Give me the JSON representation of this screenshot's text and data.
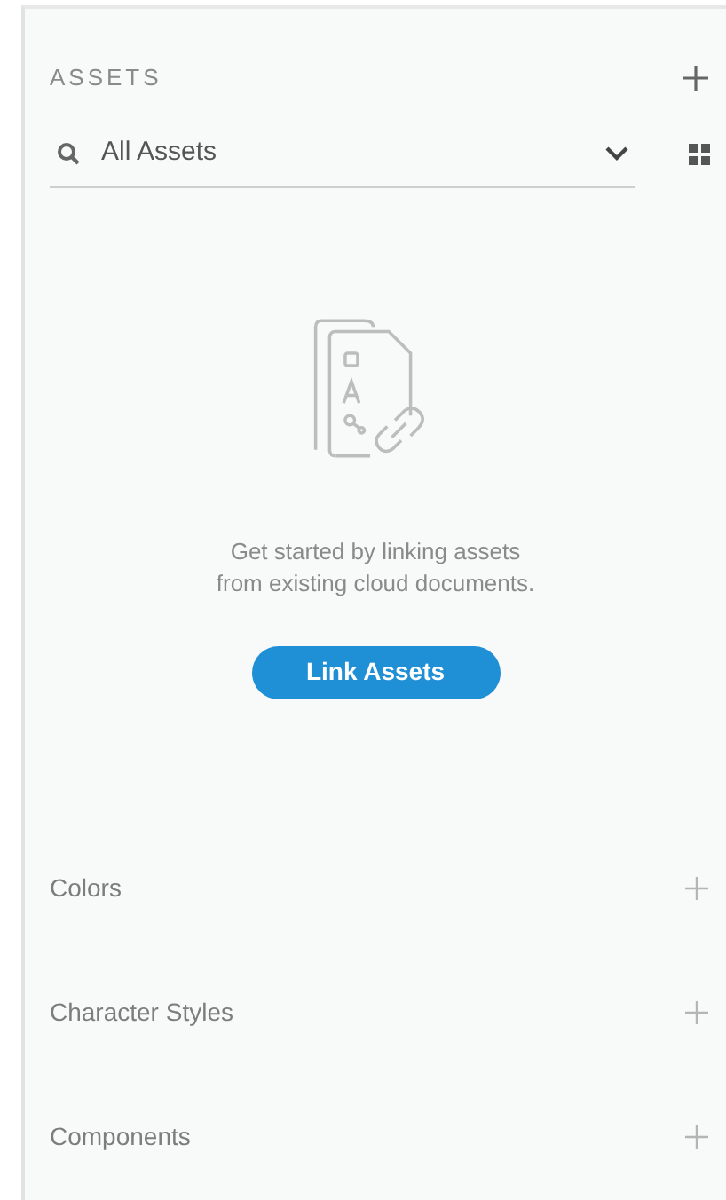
{
  "panel": {
    "title": "ASSETS"
  },
  "filter": {
    "value": "All Assets"
  },
  "empty_state": {
    "message": "Get started by linking assets from existing cloud documents.",
    "button": "Link Assets"
  },
  "sections": [
    {
      "label": "Colors"
    },
    {
      "label": "Character Styles"
    },
    {
      "label": "Components"
    }
  ]
}
